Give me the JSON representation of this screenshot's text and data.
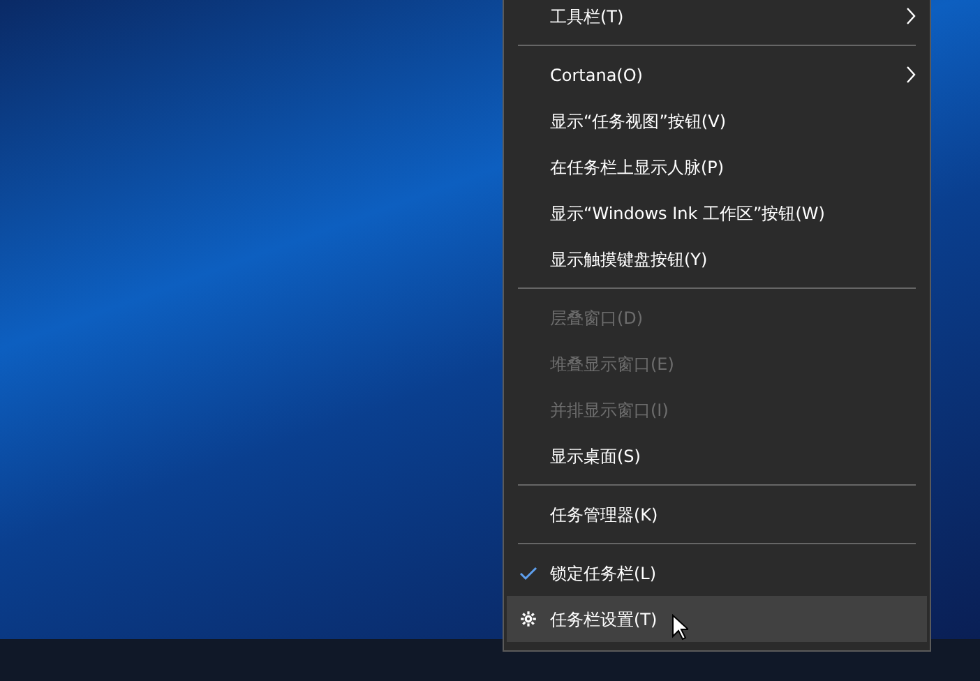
{
  "context_menu": {
    "items": [
      {
        "kind": "item",
        "label": "工具栏(T)",
        "submenu": true,
        "disabled": false,
        "checked": false,
        "selected": false
      },
      {
        "kind": "separator"
      },
      {
        "kind": "item",
        "label": "Cortana(O)",
        "submenu": true,
        "disabled": false,
        "checked": false,
        "selected": false
      },
      {
        "kind": "item",
        "label": "显示“任务视图”按钮(V)",
        "submenu": false,
        "disabled": false,
        "checked": false,
        "selected": false
      },
      {
        "kind": "item",
        "label": "在任务栏上显示人脉(P)",
        "submenu": false,
        "disabled": false,
        "checked": false,
        "selected": false
      },
      {
        "kind": "item",
        "label": "显示“Windows Ink 工作区”按钮(W)",
        "submenu": false,
        "disabled": false,
        "checked": false,
        "selected": false
      },
      {
        "kind": "item",
        "label": "显示触摸键盘按钮(Y)",
        "submenu": false,
        "disabled": false,
        "checked": false,
        "selected": false
      },
      {
        "kind": "separator"
      },
      {
        "kind": "item",
        "label": "层叠窗口(D)",
        "submenu": false,
        "disabled": true,
        "checked": false,
        "selected": false
      },
      {
        "kind": "item",
        "label": "堆叠显示窗口(E)",
        "submenu": false,
        "disabled": true,
        "checked": false,
        "selected": false
      },
      {
        "kind": "item",
        "label": "并排显示窗口(I)",
        "submenu": false,
        "disabled": true,
        "checked": false,
        "selected": false
      },
      {
        "kind": "item",
        "label": "显示桌面(S)",
        "submenu": false,
        "disabled": false,
        "checked": false,
        "selected": false
      },
      {
        "kind": "separator"
      },
      {
        "kind": "item",
        "label": "任务管理器(K)",
        "submenu": false,
        "disabled": false,
        "checked": false,
        "selected": false
      },
      {
        "kind": "separator"
      },
      {
        "kind": "item",
        "label": "锁定任务栏(L)",
        "submenu": false,
        "disabled": false,
        "checked": true,
        "selected": false
      },
      {
        "kind": "settings",
        "label": "任务栏设置(T)",
        "submenu": false,
        "disabled": false,
        "checked": false,
        "selected": true
      }
    ]
  }
}
